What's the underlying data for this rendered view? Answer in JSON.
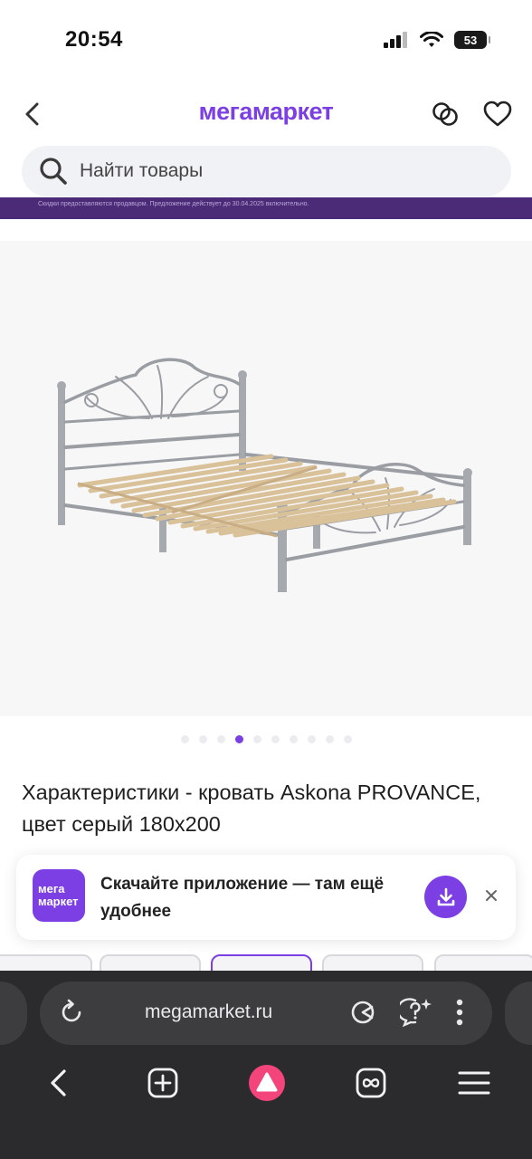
{
  "status": {
    "time": "20:54",
    "battery": "53"
  },
  "header": {
    "brand": "мегамаркет"
  },
  "search": {
    "placeholder": "Найти товары"
  },
  "promo": {
    "text": "Скидки предоставляются продавцом. Предложение действует до 30.04.2025 включительно."
  },
  "gallery": {
    "dots_total": 10,
    "active_dot": 3
  },
  "product": {
    "title": "Характеристики - кровать Askona PROVANCE, цвет серый 180х200"
  },
  "app_banner": {
    "logo_line1": "мега",
    "logo_line2": "маркет",
    "text": "Скачайте приложение — там ещё удобнее"
  },
  "browser": {
    "url": "megamarket.ru"
  },
  "colors": {
    "accent": "#7b3fe4",
    "promo_bg": "#4b2a78",
    "browser_bg": "#2b2b2d"
  }
}
